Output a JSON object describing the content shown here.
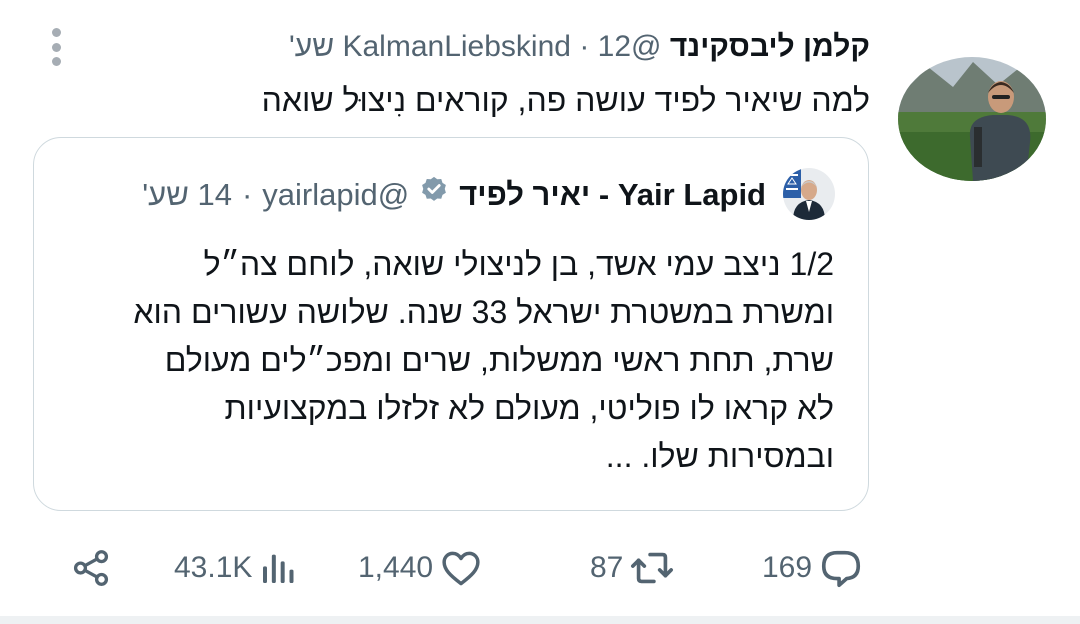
{
  "tweet": {
    "author_name": "קלמן ליבסקינד",
    "handle": "@KalmanLiebskind",
    "separator": "·",
    "time": "12 שע'",
    "text": "למה שיאיר לפיד עושה פה, קוראים נִיצוּל שואה"
  },
  "quoted": {
    "author_name": "Yair Lapid - יאיר לפיד",
    "verified_icon": "verified-badge-icon",
    "handle": "@yairlapid",
    "separator": "·",
    "time": "14 שע'",
    "lines": [
      "1/2 ניצב עמי אשד, בן לניצולי שואה, לוחם צה״ל",
      "ומשרת במשטרת ישראל 33 שנה. שלושה עשורים הוא",
      "שרת, תחת ראשי ממשלות, שרים ומפכ״לים מעולם",
      "לא קראו לו פוליטי, מעולם לא זלזלו במקצועיות",
      "ובמסירות שלו. ..."
    ]
  },
  "actions": {
    "replies": "169",
    "reposts": "87",
    "likes": "1,440",
    "views": "43.1K"
  },
  "colors": {
    "text": "#0f1419",
    "secondary": "#536471",
    "border": "#cfd9de"
  }
}
